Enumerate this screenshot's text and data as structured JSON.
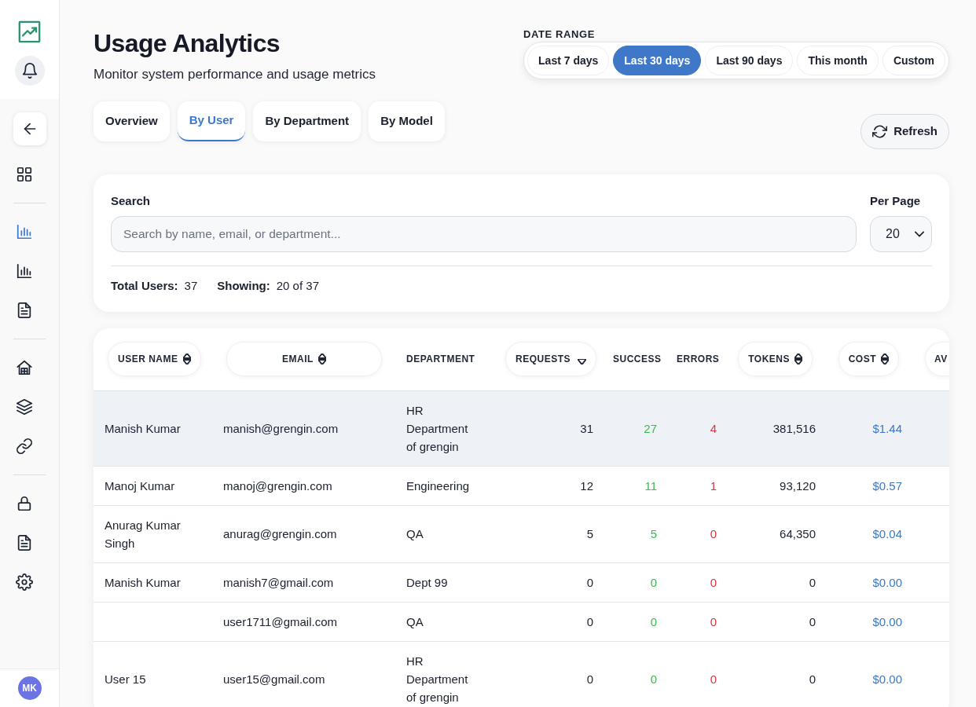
{
  "sidebar": {
    "nav_groups": [
      {
        "items": [
          {
            "kind": "grid",
            "selected": false
          }
        ]
      },
      {
        "items": [
          {
            "kind": "bar-chart",
            "selected": true
          },
          {
            "kind": "bar-chart",
            "selected": false
          },
          {
            "kind": "document",
            "selected": false
          }
        ]
      },
      {
        "items": [
          {
            "kind": "building",
            "selected": false
          },
          {
            "kind": "layers",
            "selected": false
          },
          {
            "kind": "link",
            "selected": false
          }
        ]
      },
      {
        "items": [
          {
            "kind": "lock",
            "selected": false
          },
          {
            "kind": "document",
            "selected": false
          },
          {
            "kind": "settings",
            "selected": false
          }
        ]
      }
    ],
    "avatar": {
      "initials": "MK"
    }
  },
  "header": {
    "title": "Usage Analytics",
    "subtitle": "Monitor system performance and usage metrics"
  },
  "date_range": {
    "label": "DATE RANGE",
    "options": [
      {
        "label": "Last 7 days",
        "selected": false
      },
      {
        "label": "Last 30 days",
        "selected": true
      },
      {
        "label": "Last 90 days",
        "selected": false
      },
      {
        "label": "This month",
        "selected": false
      },
      {
        "label": "Custom",
        "selected": false
      }
    ]
  },
  "tabs": [
    {
      "label": "Overview",
      "selected": false
    },
    {
      "label": "By User",
      "selected": true
    },
    {
      "label": "By Department",
      "selected": false
    },
    {
      "label": "By Model",
      "selected": false
    }
  ],
  "refresh_button": {
    "label": "Refresh"
  },
  "filters": {
    "search": {
      "label": "Search",
      "placeholder": "Search by name, email, or department..."
    },
    "per_page": {
      "label": "Per Page",
      "value": "20"
    },
    "summary": [
      {
        "label": "Total Users:",
        "value": "37"
      },
      {
        "label": "Showing:",
        "value": "20 of 37"
      }
    ]
  },
  "table": {
    "columns": [
      {
        "label": "USER NAME",
        "kind": "text",
        "sortable": true,
        "sorted": false
      },
      {
        "label": "EMAIL",
        "kind": "text",
        "sortable": true,
        "sorted": false
      },
      {
        "label": "DEPARTMENT",
        "kind": "text",
        "sortable": false
      },
      {
        "label": "REQUESTS",
        "kind": "number",
        "sortable": true,
        "sorted": true,
        "descending": true
      },
      {
        "label": "SUCCESS",
        "kind": "success",
        "sortable": false
      },
      {
        "label": "ERRORS",
        "kind": "error",
        "sortable": false
      },
      {
        "label": "TOKENS",
        "kind": "number",
        "sortable": true,
        "sorted": false
      },
      {
        "label": "COST",
        "kind": "cost",
        "sortable": true,
        "sorted": false
      },
      {
        "label": "AV",
        "kind": "number",
        "sortable": true
      }
    ],
    "rows": [
      {
        "selected": true,
        "user_name": "Manish Kumar",
        "email": "manish@grengin.com",
        "department": "HR Department of grengin",
        "requests": "31",
        "success": "27",
        "errors": "4",
        "tokens": "381,516",
        "cost": "$1.44"
      },
      {
        "selected": false,
        "user_name": "Manoj Kumar",
        "email": "manoj@grengin.com",
        "department": "Engineering",
        "requests": "12",
        "success": "11",
        "errors": "1",
        "tokens": "93,120",
        "cost": "$0.57"
      },
      {
        "selected": false,
        "user_name": "Anurag Kumar Singh",
        "email": "anurag@grengin.com",
        "department": "QA",
        "requests": "5",
        "success": "5",
        "errors": "0",
        "tokens": "64,350",
        "cost": "$0.04"
      },
      {
        "selected": false,
        "user_name": "Manish Kumar",
        "email": "manish7@gmail.com",
        "department": "Dept 99",
        "requests": "0",
        "success": "0",
        "errors": "0",
        "tokens": "0",
        "cost": "$0.00"
      },
      {
        "selected": false,
        "email": "user1711@gmail.com",
        "department": "QA",
        "requests": "0",
        "success": "0",
        "errors": "0",
        "tokens": "0",
        "cost": "$0.00"
      },
      {
        "selected": false,
        "user_name": "User 15",
        "email": "user15@gmail.com",
        "department": "HR Department of grengin",
        "requests": "0",
        "success": "0",
        "errors": "0",
        "tokens": "0",
        "cost": "$0.00"
      }
    ]
  }
}
